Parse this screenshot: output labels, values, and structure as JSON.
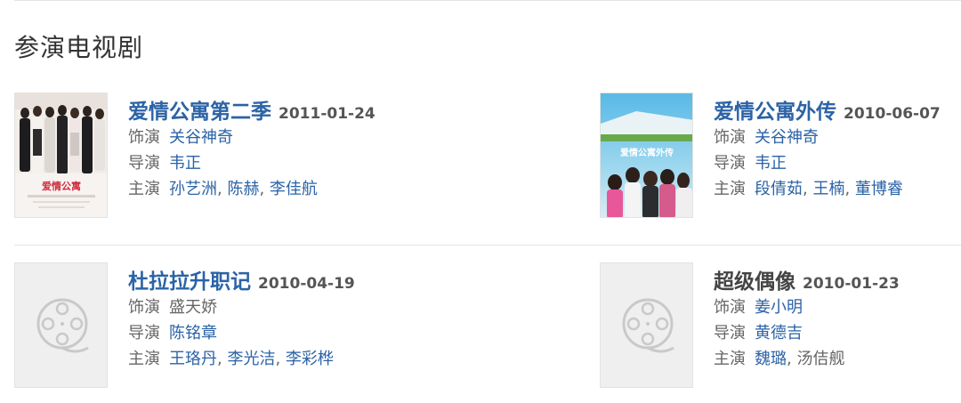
{
  "section": {
    "title": "参演电视剧"
  },
  "labels": {
    "role": "饰演",
    "director": "导演",
    "cast": "主演"
  },
  "separator": ", ",
  "shows": [
    {
      "title": "爱情公寓第二季",
      "date": "2011-01-24",
      "role": "关谷神奇",
      "director": "韦正",
      "cast": [
        "孙艺洲",
        "陈赫",
        "李佳航"
      ],
      "poster": "photo",
      "poster_text": "爱情公寓"
    },
    {
      "title": "爱情公寓外传",
      "date": "2010-06-07",
      "role": "关谷神奇",
      "director": "韦正",
      "cast": [
        "段倩茹",
        "王楠",
        "董博睿"
      ],
      "poster": "photo",
      "poster_text": "爱情公寓外传"
    },
    {
      "title": "杜拉拉升职记",
      "date": "2010-04-19",
      "role": "盛天娇",
      "director": "陈铭章",
      "cast": [
        "王珞丹",
        "李光洁",
        "李彩桦"
      ],
      "poster": "placeholder",
      "role_linked": false
    },
    {
      "title": "超级偶像",
      "date": "2010-01-23",
      "role": "姜小明",
      "director": "黄德吉",
      "cast": [
        "魏璐",
        "汤佶舰"
      ],
      "poster": "placeholder",
      "title_linked": false
    }
  ],
  "colors": {
    "link": "#2b63a6",
    "muted": "#666666",
    "divider": "#e6e6e6",
    "placeholder": "#efefef"
  },
  "icons": {
    "placeholder": "film-reel-icon"
  }
}
